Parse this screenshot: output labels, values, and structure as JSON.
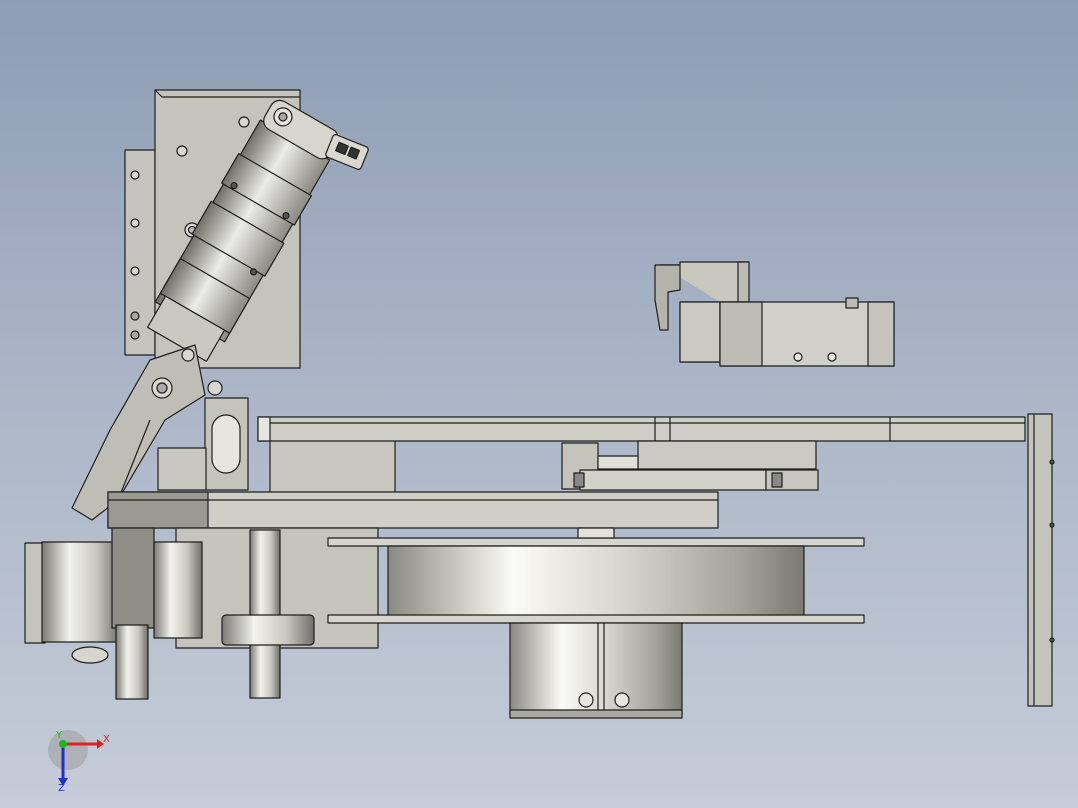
{
  "viewport": {
    "background_top": "#8d9db4",
    "background_bottom": "#c6ccd8"
  },
  "triad": {
    "x_label": "X",
    "y_label": "Y",
    "z_label": "Z",
    "x_color": "#e02020",
    "y_color": "#18b818",
    "z_color": "#2030d0"
  },
  "model": {
    "body_color": "#c4c4bc",
    "edge_color": "#1e1e1e",
    "shade_color": "#9a9a92"
  }
}
